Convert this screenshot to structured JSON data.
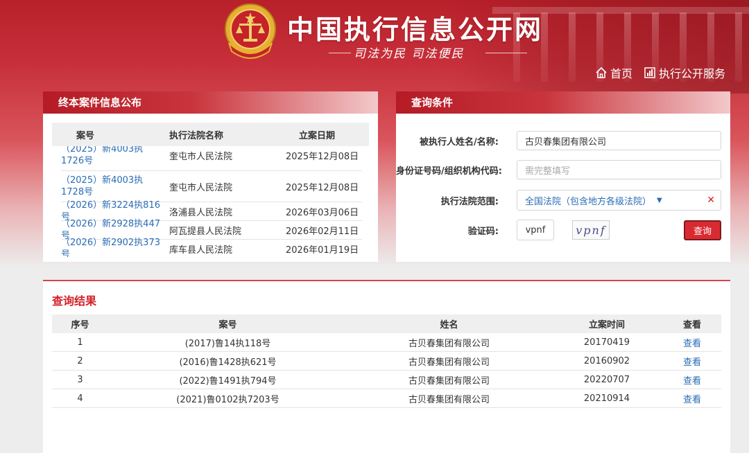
{
  "header": {
    "site_title": "中国执行信息公开网",
    "slogan": "司法为民   司法便民",
    "nav": [
      {
        "label": "首页",
        "icon": "home-icon"
      },
      {
        "label": "执行公开服务",
        "icon": "chart-icon"
      }
    ]
  },
  "left_panel": {
    "title": "终本案件信息公布",
    "columns": [
      "案号",
      "执行法院名称",
      "立案日期"
    ],
    "rows": [
      {
        "case_no": "（2025）新4003执1726号",
        "court": "奎屯市人民法院",
        "date": "2025年12月08日"
      },
      {
        "case_no": "（2025）新4003执1728号",
        "court": "奎屯市人民法院",
        "date": "2025年12月08日"
      },
      {
        "case_no": "（2026）新3224执816号",
        "court": "洛浦县人民法院",
        "date": "2026年03月06日"
      },
      {
        "case_no": "（2026）新2928执447号",
        "court": "阿瓦提县人民法院",
        "date": "2026年02月11日"
      },
      {
        "case_no": "（2026）新2902执373号",
        "court": "库车县人民法院",
        "date": "2026年01月19日"
      }
    ]
  },
  "query_panel": {
    "title": "查询条件",
    "name_label": "被执行人姓名/名称:",
    "name_value": "古贝春集团有限公司",
    "id_label": "身份证号码/组织机构代码:",
    "id_placeholder": "需完整填写",
    "court_label": "执行法院范围:",
    "court_value": "全国法院（包含地方各级法院）",
    "captcha_label": "验证码:",
    "captcha_value": "vpnf",
    "captcha_image_text": "vpnf",
    "query_button": "查询"
  },
  "results": {
    "title": "查询结果",
    "columns": [
      "序号",
      "案号",
      "姓名",
      "立案时间",
      "查看"
    ],
    "rows": [
      {
        "no": "1",
        "case_no": "(2017)鲁14执118号",
        "name": "古贝春集团有限公司",
        "date": "20170419",
        "action": "查看"
      },
      {
        "no": "2",
        "case_no": "(2016)鲁1428执621号",
        "name": "古贝春集团有限公司",
        "date": "20160902",
        "action": "查看"
      },
      {
        "no": "3",
        "case_no": "(2022)鲁1491执794号",
        "name": "古贝春集团有限公司",
        "date": "20220707",
        "action": "查看"
      },
      {
        "no": "4",
        "case_no": "(2021)鲁0102执7203号",
        "name": "古贝春集团有限公司",
        "date": "20210914",
        "action": "查看"
      }
    ]
  },
  "colors": {
    "brand_red": "#b8202a",
    "link_blue": "#2a6cb5",
    "button_red": "#d92a32"
  }
}
